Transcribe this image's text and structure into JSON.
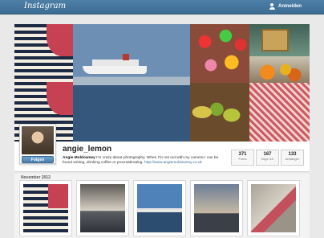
{
  "topbar": {
    "logo": "Instagram",
    "login_label": "Anmelden"
  },
  "cover": {
    "tiles": [
      "striped-shirt",
      "cruise-ship",
      "gummy-candy",
      "fruit-bowl",
      "picture-frame",
      "autumn-leaves",
      "patterned-fabric"
    ]
  },
  "profile": {
    "username": "angie_lemon",
    "follow_label": "Folgen",
    "bio_name": "Angie Muldowney",
    "bio_text": "I'm crazy about photography. When I'm not out with my camera I can be found writing, drinking coffee or procrastinating.",
    "bio_link": "http://www.angiemuldowney.co.uk",
    "stats": [
      {
        "value": "371",
        "label": "Fotos"
      },
      {
        "value": "167",
        "label": "folge ich"
      },
      {
        "value": "133",
        "label": "Anhänger"
      }
    ]
  },
  "grid": {
    "month": "November 2012"
  },
  "colors": {
    "topbar": "#4e7fa6",
    "follow_button": "#4a7fae"
  }
}
